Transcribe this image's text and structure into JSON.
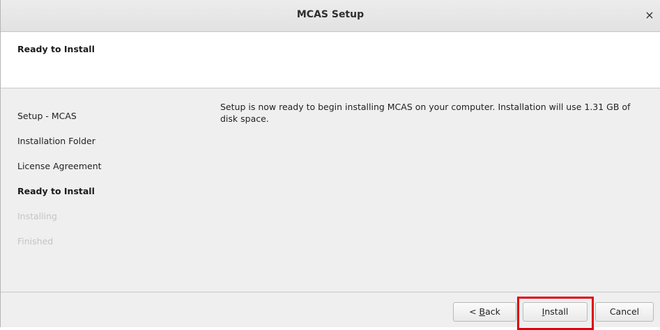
{
  "window": {
    "title": "MCAS Setup",
    "close_glyph": "×"
  },
  "header": {
    "title": "Ready to Install"
  },
  "steps": [
    {
      "label": "Setup - MCAS",
      "state": "done"
    },
    {
      "label": "Installation Folder",
      "state": "done"
    },
    {
      "label": "License Agreement",
      "state": "done"
    },
    {
      "label": "Ready to Install",
      "state": "current"
    },
    {
      "label": "Installing",
      "state": "future"
    },
    {
      "label": "Finished",
      "state": "future"
    }
  ],
  "content": {
    "message": "Setup is now ready to begin installing MCAS on your computer. Installation will use 1.31 GB of disk space."
  },
  "buttons": {
    "back_prefix": "< ",
    "back_mnemonic": "B",
    "back_rest": "ack",
    "install_mnemonic": "I",
    "install_rest": "nstall",
    "cancel": "Cancel"
  },
  "colors": {
    "highlight": "#e0000f",
    "future_step": "#c4c4c4"
  }
}
